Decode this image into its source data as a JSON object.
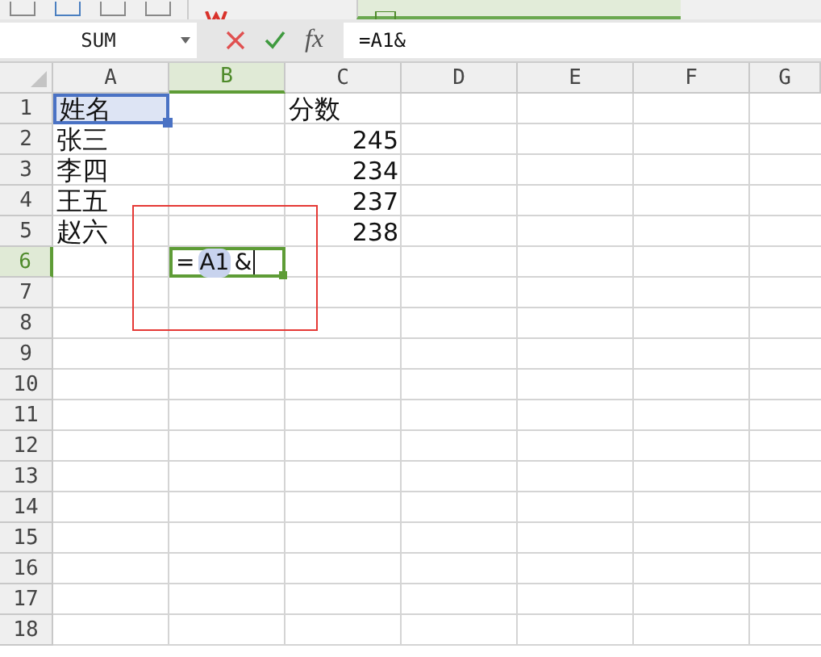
{
  "tabs": [
    {
      "kind": "home",
      "selected": false
    },
    {
      "kind": "sheet",
      "selected": true
    }
  ],
  "formula_bar": {
    "name_box": "SUM",
    "function_label": "fx",
    "formula": "=A1&"
  },
  "columns": [
    {
      "label": "A",
      "selected": false
    },
    {
      "label": "B",
      "selected": true
    },
    {
      "label": "C",
      "selected": false
    },
    {
      "label": "D",
      "selected": false
    },
    {
      "label": "E",
      "selected": false
    },
    {
      "label": "F",
      "selected": false
    },
    {
      "label": "G",
      "selected": false
    }
  ],
  "rows": [
    {
      "label": "1",
      "selected": false,
      "cells": [
        {
          "kind": "reference",
          "text": "姓名"
        },
        {
          "kind": "empty"
        },
        {
          "kind": "text",
          "text": "分数"
        }
      ]
    },
    {
      "label": "2",
      "selected": false,
      "cells": [
        {
          "kind": "text",
          "text": "张三"
        },
        {
          "kind": "empty"
        },
        {
          "kind": "number",
          "text": "245"
        }
      ]
    },
    {
      "label": "3",
      "selected": false,
      "cells": [
        {
          "kind": "text",
          "text": "李四"
        },
        {
          "kind": "empty"
        },
        {
          "kind": "number",
          "text": "234"
        }
      ]
    },
    {
      "label": "4",
      "selected": false,
      "cells": [
        {
          "kind": "text",
          "text": "王五"
        },
        {
          "kind": "empty"
        },
        {
          "kind": "number",
          "text": "237"
        }
      ]
    },
    {
      "label": "5",
      "selected": false,
      "cells": [
        {
          "kind": "text",
          "text": "赵六"
        },
        {
          "kind": "empty"
        },
        {
          "kind": "number",
          "text": "238"
        }
      ]
    },
    {
      "label": "6",
      "selected": true,
      "cells": [
        {
          "kind": "empty"
        },
        {
          "kind": "editing",
          "parts": [
            {
              "kind": "plain",
              "text": "="
            },
            {
              "kind": "reference",
              "text": "A1"
            },
            {
              "kind": "plain",
              "text": "&"
            }
          ]
        }
      ]
    },
    {
      "label": "7",
      "selected": false,
      "cells": []
    },
    {
      "label": "8",
      "selected": false,
      "cells": []
    },
    {
      "label": "9",
      "selected": false,
      "cells": []
    },
    {
      "label": "10",
      "selected": false,
      "cells": []
    },
    {
      "label": "11",
      "selected": false,
      "cells": []
    },
    {
      "label": "12",
      "selected": false,
      "cells": []
    },
    {
      "label": "13",
      "selected": false,
      "cells": []
    },
    {
      "label": "14",
      "selected": false,
      "cells": []
    },
    {
      "label": "15",
      "selected": false,
      "cells": []
    },
    {
      "label": "16",
      "selected": false,
      "cells": []
    },
    {
      "label": "17",
      "selected": false,
      "cells": []
    },
    {
      "label": "18",
      "selected": false,
      "cells": []
    }
  ]
}
